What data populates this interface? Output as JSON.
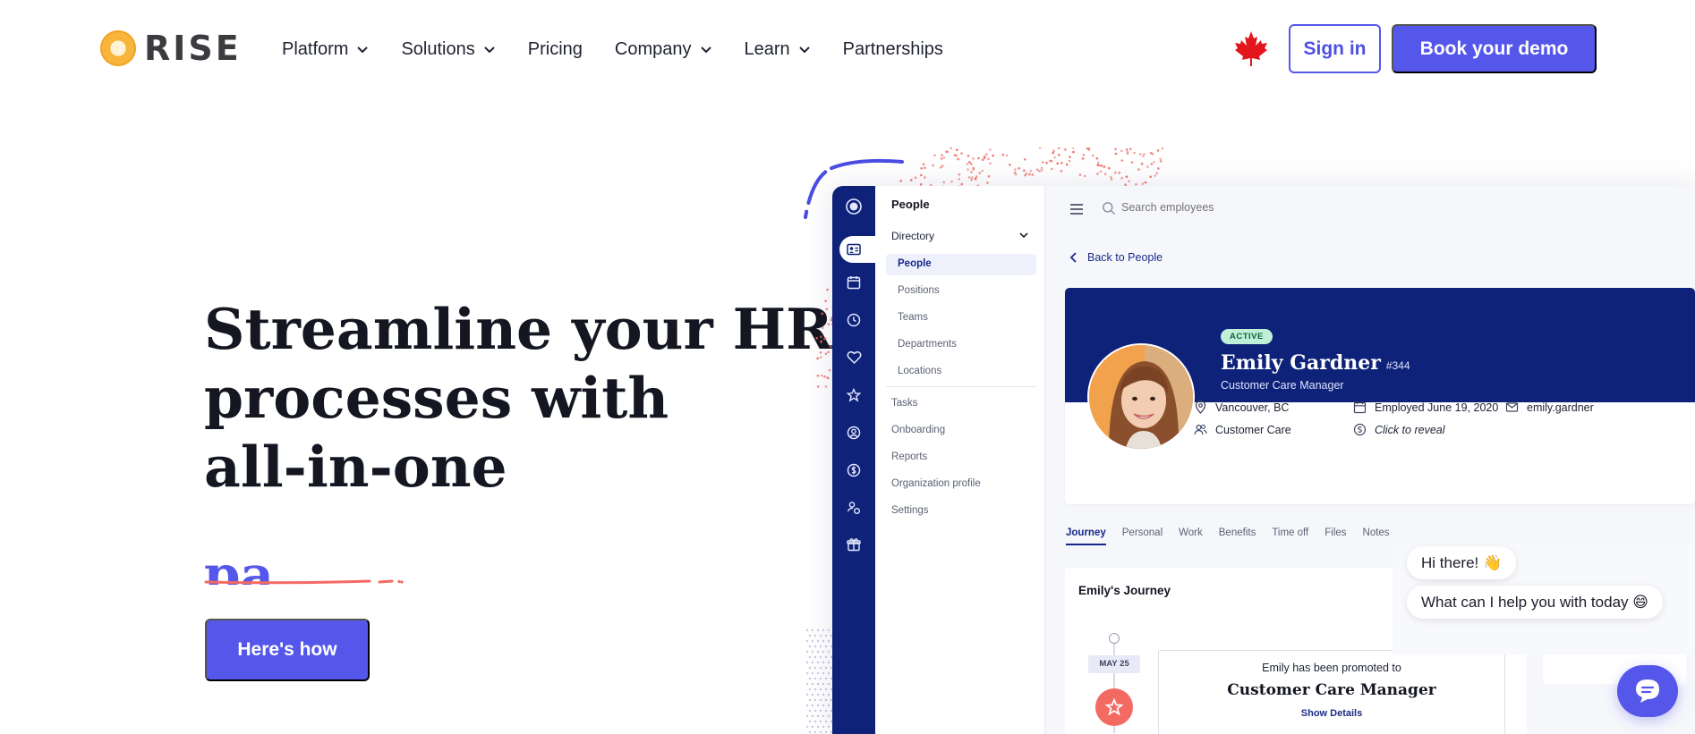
{
  "brand": {
    "name": "RISE",
    "accent": "#5557ea",
    "logo_color": "#f7b53b"
  },
  "nav": {
    "items": [
      {
        "label": "Platform",
        "dropdown": true
      },
      {
        "label": "Solutions",
        "dropdown": true
      },
      {
        "label": "Pricing",
        "dropdown": false
      },
      {
        "label": "Company",
        "dropdown": true
      },
      {
        "label": "Learn",
        "dropdown": true
      },
      {
        "label": "Partnerships",
        "dropdown": false
      }
    ],
    "flag_icon": "maple-leaf-icon",
    "signin_label": "Sign in",
    "demo_label": "Book your demo"
  },
  "hero": {
    "title_lines": [
      "Streamline your HR",
      "processes with",
      "all-in-one"
    ],
    "typing_text": "pa",
    "cta_label": "Here's how"
  },
  "app": {
    "subnav": {
      "title": "People",
      "directory_label": "Directory",
      "directory_items": [
        "People",
        "Positions",
        "Teams",
        "Departments",
        "Locations"
      ],
      "other_items": [
        "Tasks",
        "Onboarding",
        "Reports",
        "Organization profile",
        "Settings"
      ]
    },
    "search_placeholder": "Search employees",
    "back_label": "Back to People",
    "profile": {
      "status": "ACTIVE",
      "name": "Emily Gardner",
      "number": "#344",
      "role": "Customer Care Manager",
      "location": "Vancouver, BC",
      "department": "Customer Care",
      "employed": "Employed June 19, 2020",
      "reveal": "Click to reveal",
      "email": "emily.gardner"
    },
    "tabs": [
      "Journey",
      "Personal",
      "Work",
      "Benefits",
      "Time off",
      "Files",
      "Notes"
    ],
    "journey": {
      "title": "Emily's Journey",
      "date": "MAY 25",
      "event_line1": "Emily has been promoted to",
      "event_line2": "Customer Care Manager",
      "event_link": "Show Details"
    }
  },
  "chat": {
    "greeting": "Hi there! 👋",
    "question": "What can I help you with today 😄"
  }
}
